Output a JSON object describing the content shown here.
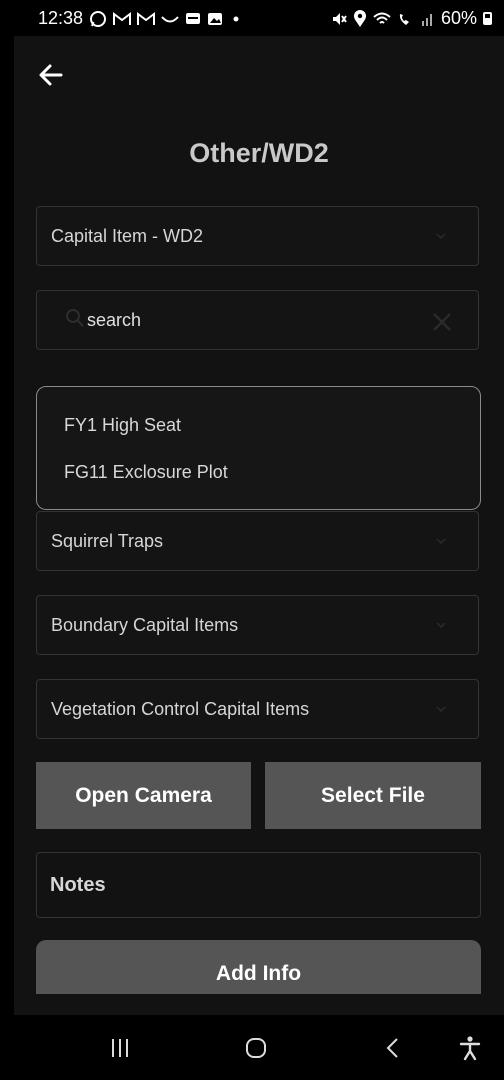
{
  "status": {
    "time": "12:38",
    "left_icons": [
      "whatsapp-icon",
      "gmail-icon",
      "gmail-icon",
      "wave-icon",
      "card-icon",
      "image-icon",
      "dot-icon"
    ],
    "right_icons": [
      "mute-icon",
      "location-icon",
      "wifi-icon",
      "wifi-call-icon",
      "signal-icon"
    ],
    "battery": "60%"
  },
  "header": {
    "back_icon": "arrow-left-icon",
    "title": "Other/WD2"
  },
  "capital_select": {
    "value": "Capital Item - WD2"
  },
  "search": {
    "text": "search"
  },
  "dropdown": {
    "items": [
      "FY1 High Seat",
      "FG11 Exclosure Plot"
    ]
  },
  "sections": [
    "Squirrel Traps",
    "Boundary Capital Items",
    "Vegetation Control Capital Items"
  ],
  "buttons": {
    "open_camera": "Open Camera",
    "select_file": "Select File",
    "add_info": "Add Info"
  },
  "notes": {
    "label": "Notes"
  },
  "navbar": {
    "icons": [
      "recents-icon",
      "home-icon",
      "back-icon",
      "accessibility-icon"
    ]
  },
  "colors": {
    "background": "#121212",
    "button": "#555555",
    "border": "#333333"
  }
}
